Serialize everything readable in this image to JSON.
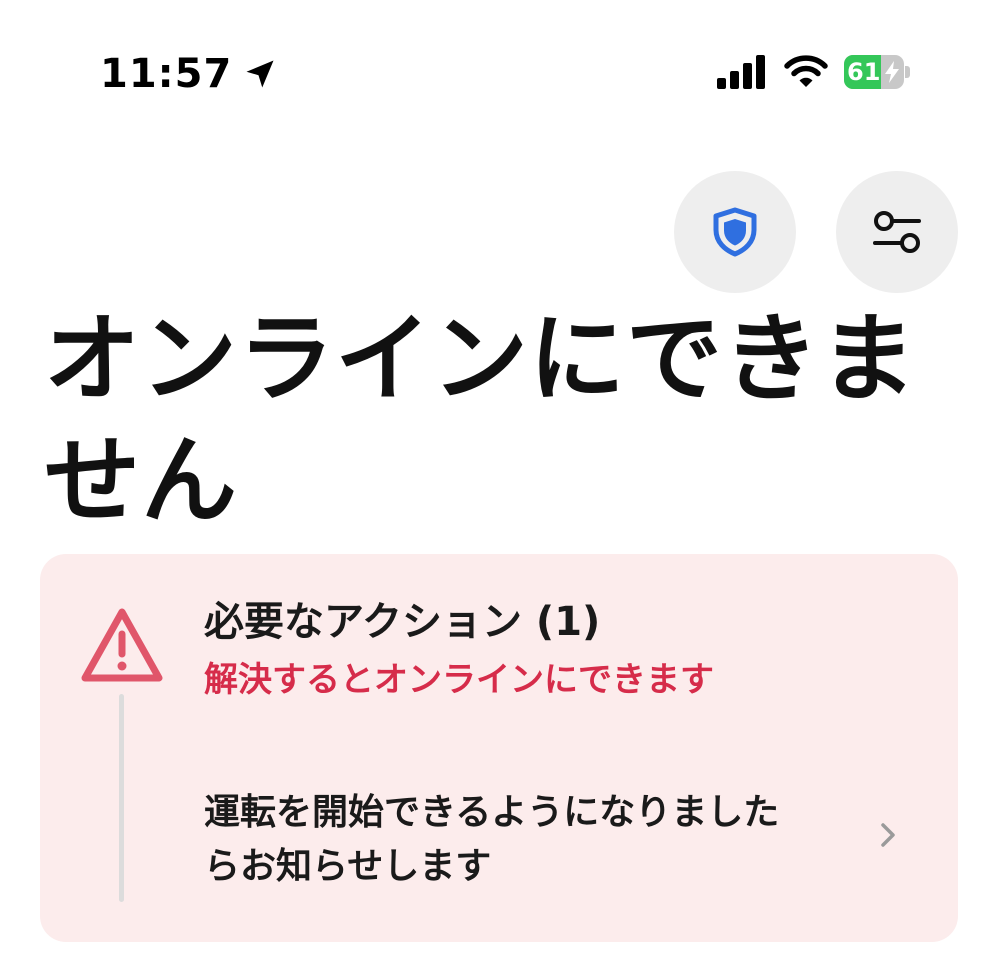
{
  "status_bar": {
    "time": "11:57",
    "battery_level": "61",
    "battery_fraction": 0.61,
    "icons": [
      "location-arrow-icon",
      "cellular-signal-icon",
      "wifi-icon",
      "battery-charging-icon"
    ]
  },
  "header": {
    "buttons": [
      {
        "name": "shield-button",
        "icon": "shield-icon"
      },
      {
        "name": "filter-button",
        "icon": "sliders-icon"
      }
    ]
  },
  "title": "オンラインにできません",
  "alert": {
    "icon": "warning-triangle-icon",
    "heading": "必要なアクション (1)",
    "subtitle": "解決するとオンラインにできます",
    "message": "運転を開始できるようになりましたらお知らせします",
    "chevron_icon": "chevron-right-icon"
  },
  "colors": {
    "accent_red": "#d62c4a",
    "warning_icon": "#e0566a",
    "card_background": "#fcecec",
    "shield_blue": "#2f6fe0",
    "battery_green": "#34c759",
    "round_button_background": "#eeeeee"
  }
}
